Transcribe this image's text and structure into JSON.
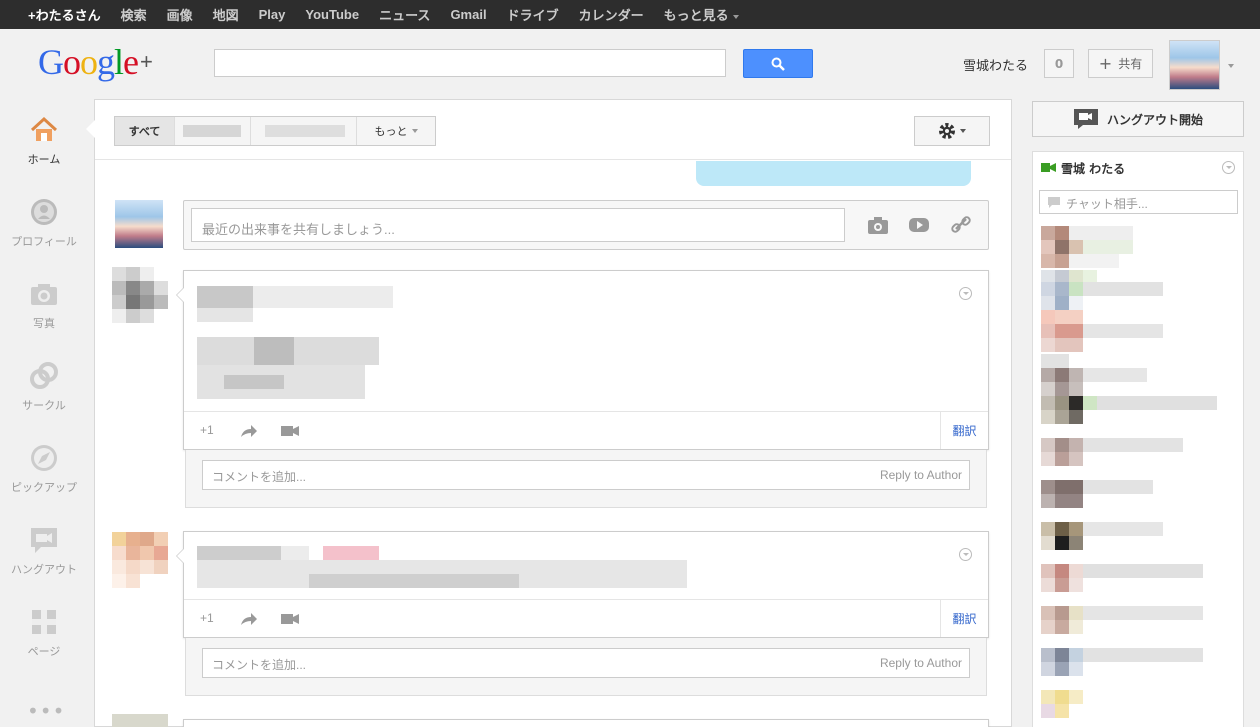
{
  "topbar": {
    "items": [
      "+わたるさん",
      "検索",
      "画像",
      "地図",
      "Play",
      "YouTube",
      "ニュース",
      "Gmail",
      "ドライブ",
      "カレンダー",
      "もっと見る"
    ]
  },
  "header": {
    "logo": "Google",
    "logo_plus": "+",
    "search_placeholder": "",
    "username": "雪城わたる",
    "notif_count": "0",
    "share_label": "共有"
  },
  "leftnav": {
    "items": [
      {
        "label": "ホーム",
        "icon": "home-icon"
      },
      {
        "label": "プロフィール",
        "icon": "profile-icon"
      },
      {
        "label": "写真",
        "icon": "camera-icon"
      },
      {
        "label": "サークル",
        "icon": "circles-icon"
      },
      {
        "label": "ピックアップ",
        "icon": "compass-icon"
      },
      {
        "label": "ハングアウト",
        "icon": "hangout-icon"
      },
      {
        "label": "ページ",
        "icon": "pages-icon"
      }
    ]
  },
  "stream": {
    "tabs": {
      "all": "すべて",
      "more": "もっと"
    },
    "share_placeholder": "最近の出来事を共有しましょう...",
    "post_actions": {
      "plusone": "+1",
      "translate": "翻訳"
    },
    "comment_placeholder": "コメントを追加...",
    "reply_label": "Reply to Author"
  },
  "right": {
    "hangout_start": "ハングアウト開始",
    "chat_user": "雪城 わたる",
    "chat_search": "チャット相手..."
  },
  "colors": {
    "topbar": "#2d2d2d",
    "search_button": "#4d90fe",
    "link": "#3366cc",
    "notice_bg": "#bde8f8"
  }
}
